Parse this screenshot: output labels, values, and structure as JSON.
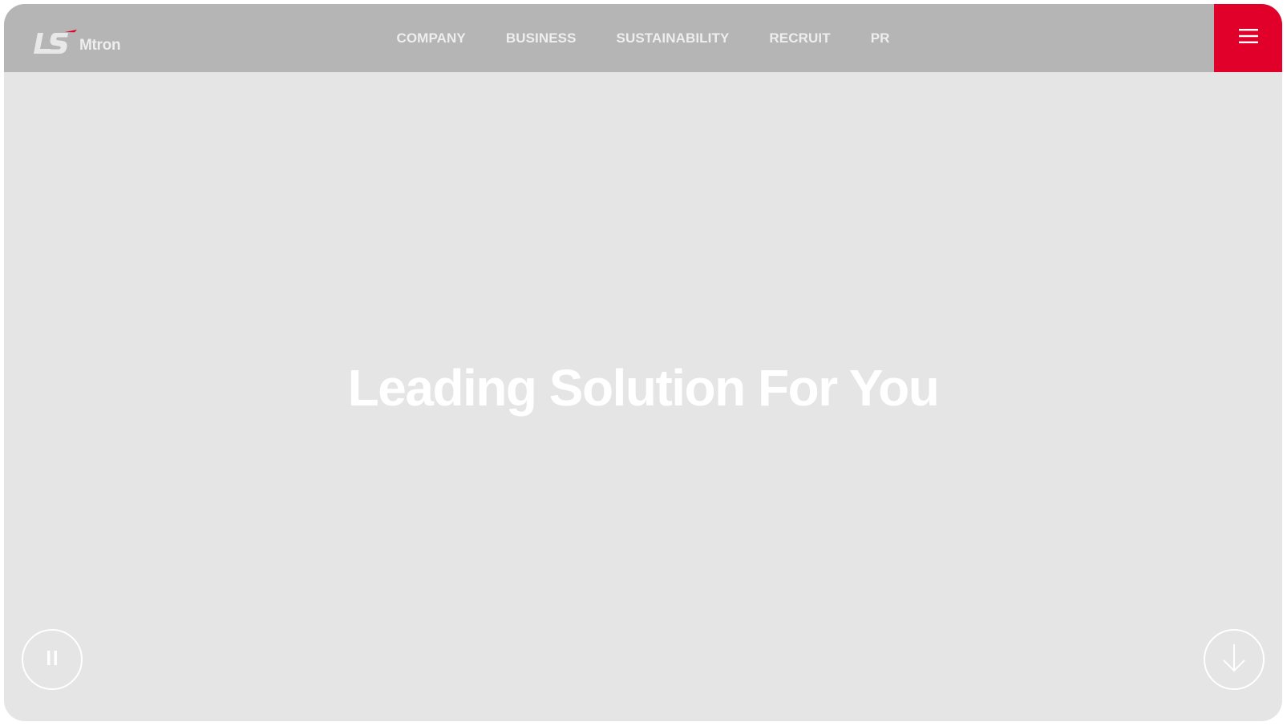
{
  "header": {
    "logo": {
      "mark_text": "LS",
      "brand_text": "Mtron",
      "mark_accent_color": "#e0002a"
    },
    "nav_items": [
      {
        "label": "COMPANY"
      },
      {
        "label": "BUSINESS"
      },
      {
        "label": "SUSTAINABILITY"
      },
      {
        "label": "RECRUIT"
      },
      {
        "label": "PR"
      }
    ],
    "menu_button": {
      "icon": "hamburger-menu-icon",
      "color": "#e0002a"
    }
  },
  "hero": {
    "title": "Leading Solution For You"
  },
  "controls": {
    "pause_button": {
      "icon": "pause-icon"
    },
    "scroll_down_button": {
      "icon": "arrow-down-icon"
    }
  },
  "colors": {
    "header_bg": "#b5b5b5",
    "page_bg": "#e5e5e5",
    "accent": "#e0002a",
    "text": "#ffffff"
  }
}
